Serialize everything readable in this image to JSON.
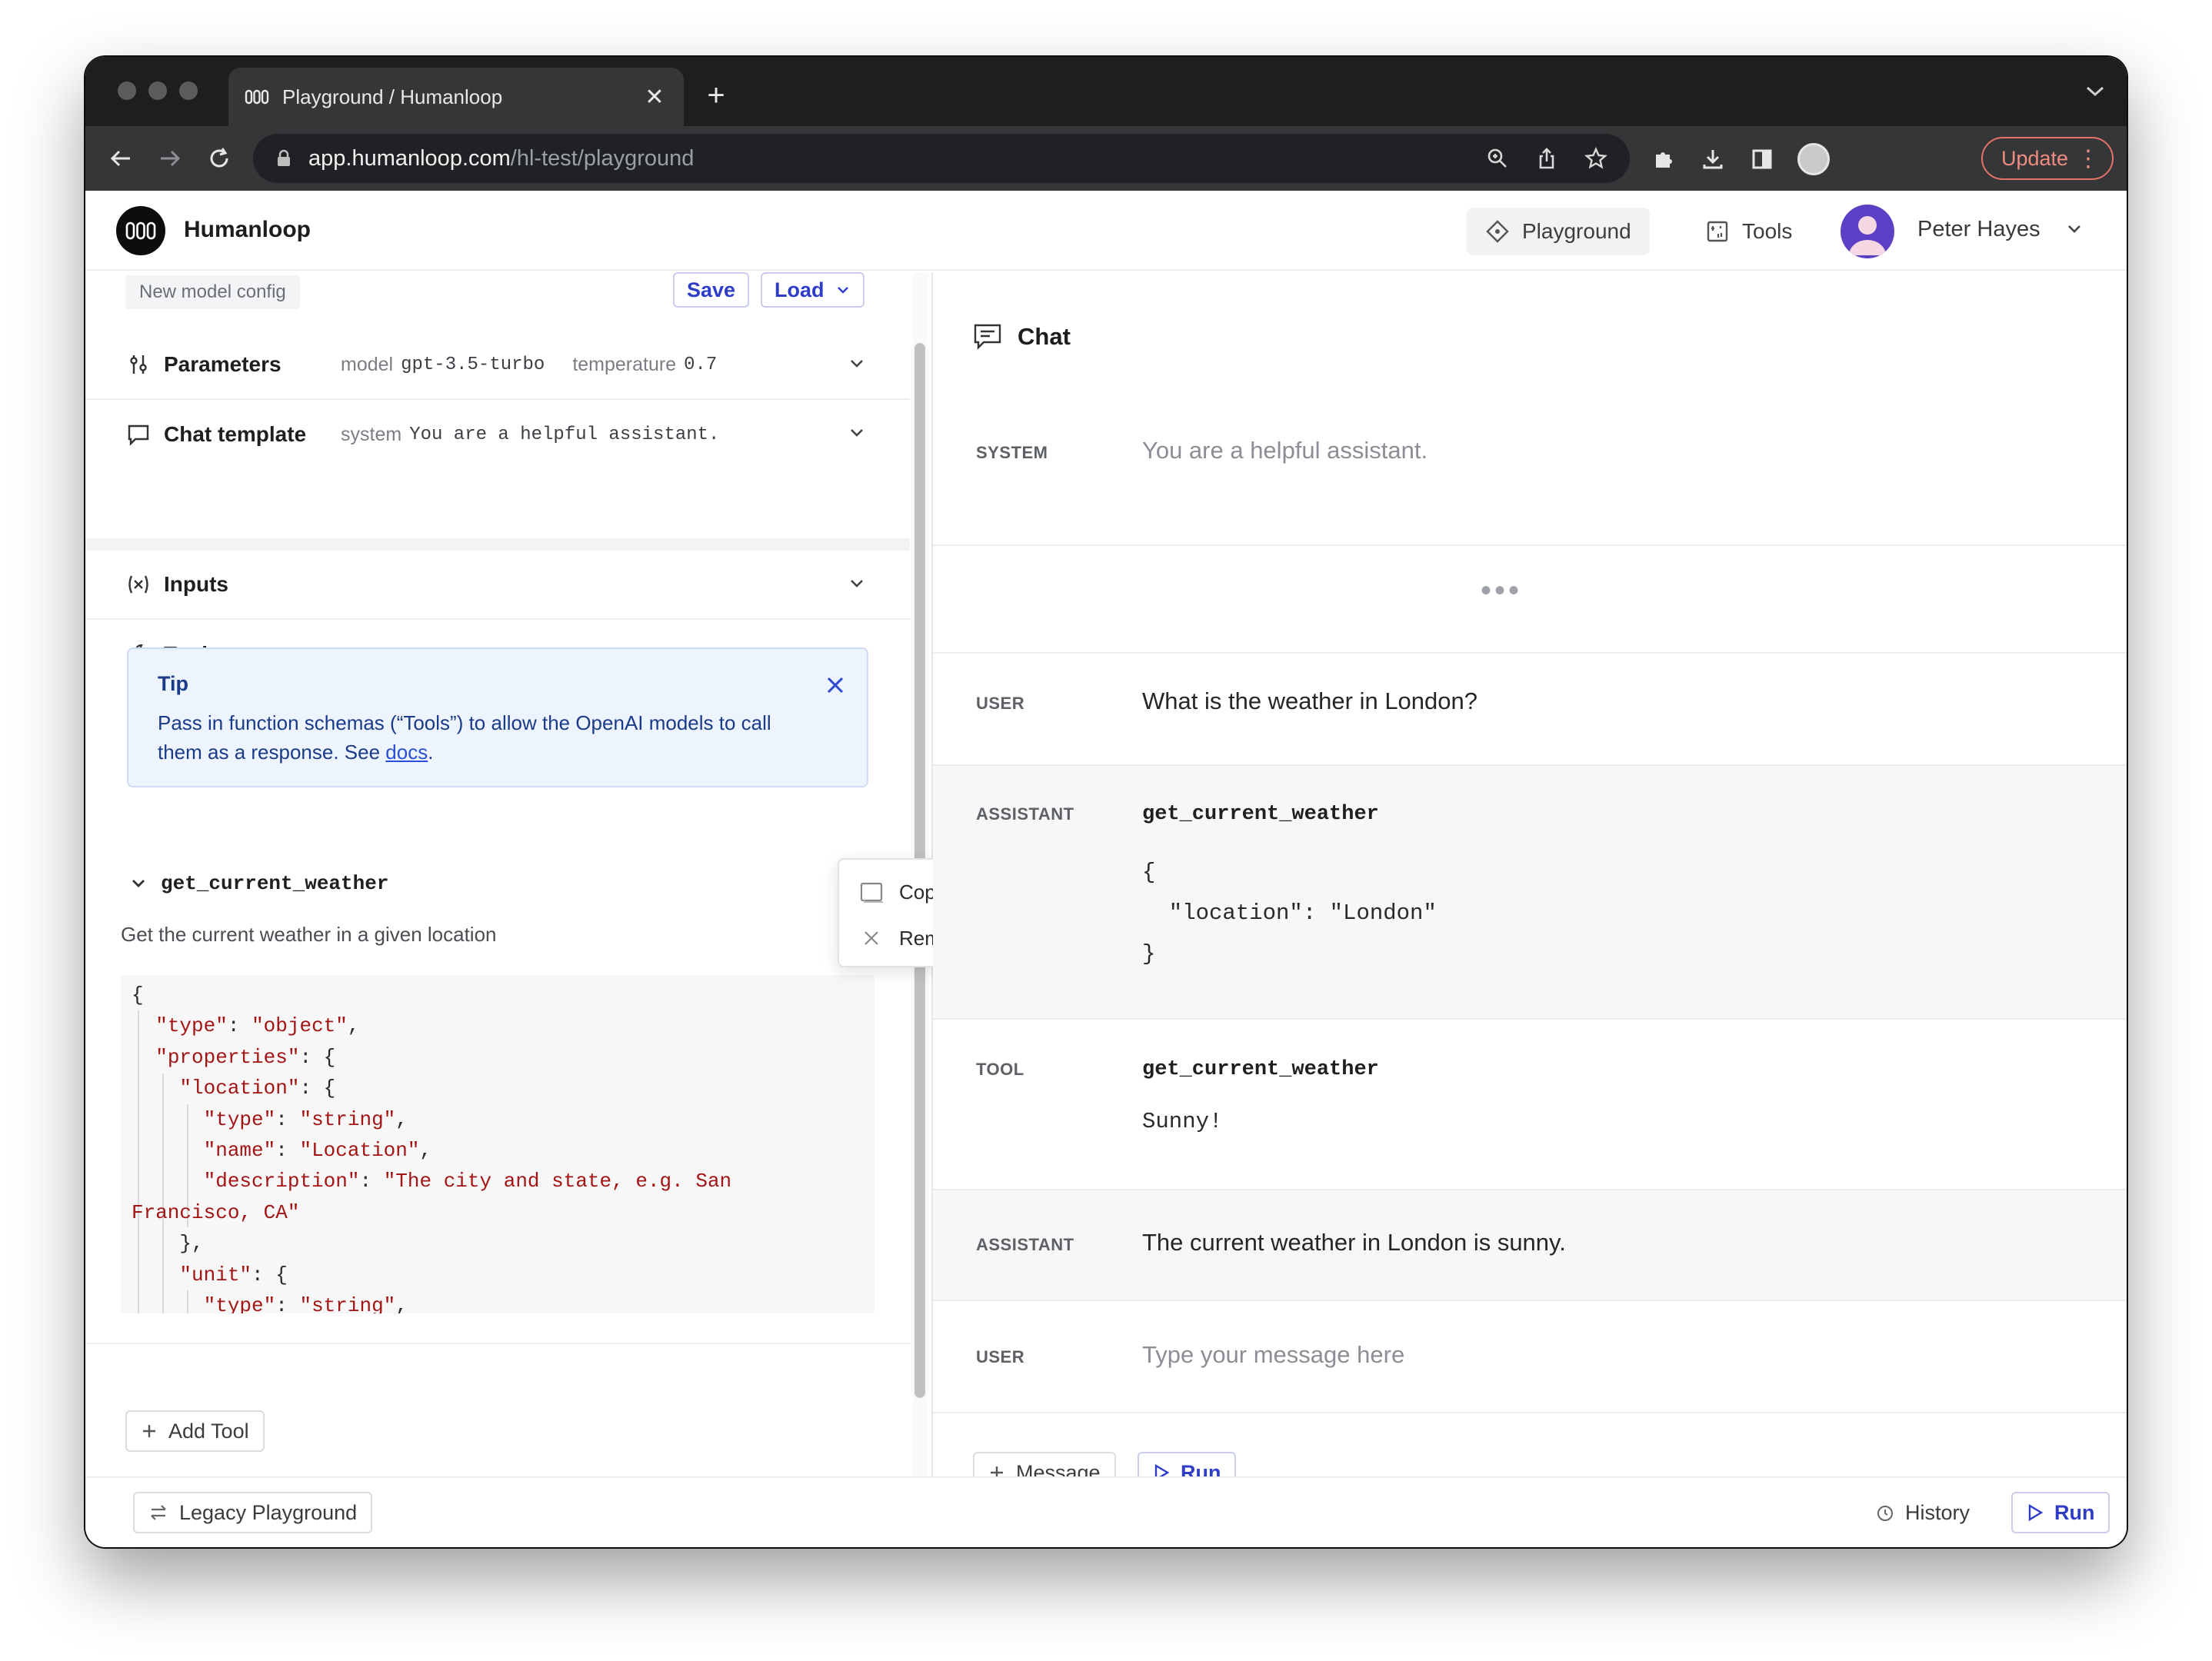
{
  "browser": {
    "tab_title": "Playground / Humanloop",
    "url_host": "app.humanloop.com",
    "url_path": "/hl-test/playground",
    "update_label": "Update"
  },
  "header": {
    "brand": "Humanloop",
    "nav": [
      {
        "label": "Playground",
        "icon": "compass-icon",
        "active": true
      },
      {
        "label": "Tools",
        "icon": "tools-icon",
        "active": false
      }
    ],
    "user_name": "Peter Hayes"
  },
  "left": {
    "config_chip": "New model config",
    "save_label": "Save",
    "load_label": "Load",
    "sections": {
      "parameters": {
        "title": "Parameters",
        "model_key": "model",
        "model_value": "gpt-3.5-turbo",
        "temp_key": "temperature",
        "temp_value": "0.7"
      },
      "chat_template": {
        "title": "Chat template",
        "system_key": "system",
        "system_value": "You are a helpful assistant."
      },
      "inputs": {
        "title": "Inputs"
      },
      "tools": {
        "title": "Tools"
      }
    },
    "tip": {
      "title": "Tip",
      "text": "Pass in function schemas (“Tools”) to allow the OpenAI models to call them as a response. See ",
      "link": "docs",
      "end": "."
    },
    "tool": {
      "name": "get_current_weather",
      "description": "Get the current weather in a given location",
      "code_lines": [
        "{",
        "  \"type\": \"object\",",
        "  \"properties\": {",
        "    \"location\": {",
        "      \"type\": \"string\",",
        "      \"name\": \"Location\",",
        "      \"description\": \"The city and state, e.g. San",
        "Francisco, CA\"",
        "    },",
        "    \"unit\": {",
        "      \"type\": \"string\","
      ]
    },
    "add_tool_label": "Add Tool",
    "legacy_label": "Legacy Playground"
  },
  "context_menu": {
    "copy": "Copy",
    "remove": "Remove"
  },
  "chat": {
    "title": "Chat",
    "messages": {
      "system": {
        "role": "SYSTEM",
        "text": "You are a helpful assistant."
      },
      "ellipsis": "•••",
      "user1": {
        "role": "USER",
        "text": "What is the weather in London?"
      },
      "assistant1": {
        "role": "ASSISTANT",
        "function": "get_current_weather",
        "args": "{\n  \"location\": \"London\"\n}"
      },
      "tool": {
        "role": "TOOL",
        "function": "get_current_weather",
        "result": "Sunny!"
      },
      "assistant2": {
        "role": "ASSISTANT",
        "text": "The current weather in London is sunny."
      },
      "user2": {
        "role": "USER",
        "placeholder": "Type your message here"
      }
    },
    "add_message_label": "Message",
    "run_label": "Run"
  },
  "footer": {
    "history_label": "History",
    "run_label": "Run"
  }
}
